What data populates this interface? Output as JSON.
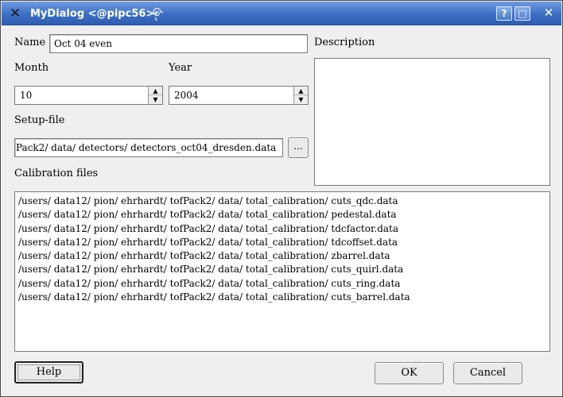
{
  "window": {
    "title": "MyDialog <@pipc56>",
    "help_glyph": "?",
    "maximize_glyph": "□",
    "close_glyph": "✕"
  },
  "form": {
    "name_label": "Name",
    "name_value": "Oct 04 even",
    "description_label": "Description",
    "month_label": "Month",
    "month_value": "10",
    "year_label": "Year",
    "year_value": "2004",
    "setup_label": "Setup-file",
    "setup_value": "Pack2/ data/ detectors/ detectors_oct04_dresden.data",
    "browse_label": "...",
    "calibration_label": "Calibration files"
  },
  "calibration_files": [
    "/users/ data12/ pion/ ehrhardt/ tofPack2/ data/ total_calibration/ cuts_qdc.data",
    "/users/ data12/ pion/ ehrhardt/ tofPack2/ data/ total_calibration/ pedestal.data",
    "/users/ data12/ pion/ ehrhardt/ tofPack2/ data/ total_calibration/ tdcfactor.data",
    "/users/ data12/ pion/ ehrhardt/ tofPack2/ data/ total_calibration/ tdcoffset.data",
    "/users/ data12/ pion/ ehrhardt/ tofPack2/ data/ total_calibration/ zbarrel.data",
    "/users/ data12/ pion/ ehrhardt/ tofPack2/ data/ total_calibration/ cuts_quirl.data",
    "/users/ data12/ pion/ ehrhardt/ tofPack2/ data/ total_calibration/ cuts_ring.data",
    "/users/ data12/ pion/ ehrhardt/ tofPack2/ data/ total_calibration/ cuts_barrel.data"
  ],
  "buttons": {
    "help": "Help",
    "ok": "OK",
    "cancel": "Cancel"
  },
  "icons": {
    "app": "x-window-icon",
    "title_decoration": "spiral-icon"
  },
  "colors": {
    "titlebar": "#3c6fc4",
    "dialog_bg": "#efefef"
  }
}
